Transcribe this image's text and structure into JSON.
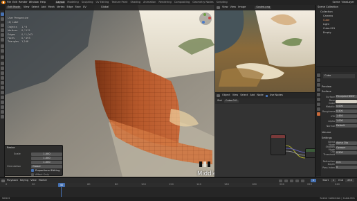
{
  "menubar": {
    "items": [
      "File",
      "Edit",
      "Render",
      "Window",
      "Help"
    ],
    "workspaces": [
      "Layout",
      "Modeling",
      "Sculpting",
      "UV Editing",
      "Texture Paint",
      "Shading",
      "Animation",
      "Rendering",
      "Compositing",
      "Geometry Nodes",
      "Scripting"
    ],
    "active_workspace": "Layout",
    "scene_label": "Scene",
    "view_layer_label": "ViewLayer"
  },
  "viewport": {
    "mode": "Edit Mode",
    "menus": [
      "View",
      "Select",
      "Add",
      "Mesh",
      "Vertex",
      "Edge",
      "Face",
      "UV"
    ],
    "transform_orientation": "Global",
    "info": {
      "title": "User Perspective",
      "collection": "(4) Cube",
      "stats": [
        {
          "label": "Objects",
          "value": "1 / 6"
        },
        {
          "label": "Vertices",
          "value": "0 / 512"
        },
        {
          "label": "Edges",
          "value": "0 / 1,003"
        },
        {
          "label": "Faces",
          "value": "0 / 493"
        },
        {
          "label": "Triangles",
          "value": "1,248"
        }
      ]
    },
    "stage_label": "Middle"
  },
  "redo_panel": {
    "title": "Resize",
    "scale_label": "Scale",
    "scale_x": "1.000",
    "scale_y": "1.000",
    "scale_z": "1.000",
    "orientation_label": "Orientation",
    "orientation_value": "Global",
    "proportional_editing": "Proportional Editing",
    "affect_only": "Affect Only"
  },
  "image_editor": {
    "menus": [
      "View",
      "View",
      "Image"
    ],
    "image_name": "Scaled.png"
  },
  "node_editor": {
    "menus": [
      "Object",
      "View",
      "Select",
      "Add",
      "Node"
    ],
    "use_nodes": "Use Nodes",
    "slot": "Slot",
    "material": "Cube.001"
  },
  "outliner": {
    "title": "Scene Collection",
    "items": [
      "Collection",
      "Camera",
      "Cube",
      "Light",
      "Cube.001",
      "Empty"
    ]
  },
  "properties": {
    "material_name": "Cube",
    "sections": [
      "Preview",
      "Surface",
      "Volume",
      "Settings"
    ],
    "rows": [
      {
        "label": "Surface",
        "value": "Principled BSDF"
      },
      {
        "label": "Base Color",
        "value": ""
      },
      {
        "label": "Metallic",
        "value": "0.000"
      },
      {
        "label": "Roughness",
        "value": "0.500"
      },
      {
        "label": "IOR",
        "value": "1.450"
      },
      {
        "label": "Alpha",
        "value": "1.000"
      },
      {
        "label": "Normal",
        "value": "Default"
      },
      {
        "label": "Blend Mode",
        "value": "Alpha Clip"
      },
      {
        "label": "Shadow Mode",
        "value": "Opaque"
      },
      {
        "label": "Clip Threshold",
        "value": "0.500"
      },
      {
        "label": "Refraction Depth",
        "value": "0 m"
      },
      {
        "label": "Pass Index",
        "value": "0"
      }
    ]
  },
  "timeline": {
    "menus": [
      "Playback",
      "Keying",
      "View",
      "Marker"
    ],
    "current_frame": "1",
    "start_label": "Start",
    "start_value": "1",
    "end_label": "End",
    "end_value": "250",
    "ticks": [
      "0",
      "20",
      "40",
      "60",
      "80",
      "100",
      "120",
      "140",
      "160",
      "180",
      "200",
      "220",
      "240"
    ]
  },
  "statusbar": {
    "left": "Select",
    "right": "Scene Collection | Cube.001"
  }
}
